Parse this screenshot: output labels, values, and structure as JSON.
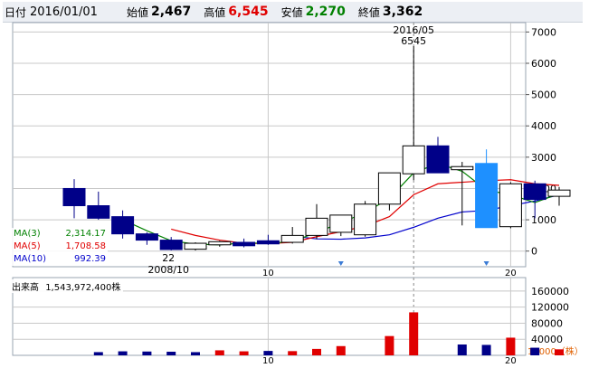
{
  "ohlc": {
    "date_label": "日付",
    "date": "2016/01/01",
    "open_label": "始値",
    "open": "2,467",
    "high_label": "高値",
    "high": "6,545",
    "low_label": "安値",
    "low": "2,270",
    "close_label": "終値",
    "close": "3,362"
  },
  "legend": {
    "ma3_label": "MA(3)",
    "ma3_value": "2,314.17",
    "ma3_color": "#008000",
    "ma5_label": "MA(5)",
    "ma5_value": "1,708.58",
    "ma5_color": "#e00000",
    "ma10_label": "MA(10)",
    "ma10_value": "992.39",
    "ma10_color": "#0000cc"
  },
  "volume_legend": {
    "label": "出来高",
    "value": "1,543,972,400株"
  },
  "colors": {
    "up": "#e00000",
    "down": "#000088",
    "highlight": "#1e90ff",
    "grid": "#c8c8c8"
  },
  "chart_data": [
    {
      "type": "candlestick",
      "yticks": [
        "0",
        "1000",
        "2000",
        "3000",
        "4000",
        "5000",
        "6000",
        "7000"
      ],
      "ylim": [
        -500,
        7300
      ],
      "xticks": [
        {
          "index": 8,
          "label": "10"
        },
        {
          "index": 18,
          "label": "20"
        }
      ],
      "candles": [
        {
          "o": 2000,
          "h": 2300,
          "l": 1050,
          "c": 1450
        },
        {
          "o": 1450,
          "h": 1900,
          "l": 1000,
          "c": 1050
        },
        {
          "o": 1100,
          "h": 1300,
          "l": 400,
          "c": 550
        },
        {
          "o": 550,
          "h": 600,
          "l": 200,
          "c": 350
        },
        {
          "o": 350,
          "h": 450,
          "l": 22,
          "c": 50
        },
        {
          "o": 60,
          "h": 280,
          "l": 20,
          "c": 250
        },
        {
          "o": 200,
          "h": 330,
          "l": 140,
          "c": 300
        },
        {
          "o": 280,
          "h": 400,
          "l": 120,
          "c": 170
        },
        {
          "o": 330,
          "h": 520,
          "l": 200,
          "c": 230
        },
        {
          "o": 280,
          "h": 770,
          "l": 240,
          "c": 500
        },
        {
          "o": 500,
          "h": 1500,
          "l": 380,
          "c": 1050
        },
        {
          "o": 600,
          "h": 1000,
          "l": 480,
          "c": 1150
        },
        {
          "o": 520,
          "h": 1600,
          "l": 460,
          "c": 1500
        },
        {
          "o": 1500,
          "h": 2500,
          "l": 1300,
          "c": 2500
        },
        {
          "o": 2470,
          "h": 6545,
          "l": 2270,
          "c": 3362
        },
        {
          "o": 3362,
          "h": 3650,
          "l": 2700,
          "c": 2500
        },
        {
          "o": 2600,
          "h": 2850,
          "l": 820,
          "c": 2700
        },
        {
          "o": 2800,
          "h": 3250,
          "l": 800,
          "c": 750,
          "highlight": true
        },
        {
          "o": 780,
          "h": 2200,
          "l": 730,
          "c": 2150
        },
        {
          "o": 2150,
          "h": 2250,
          "l": 1050,
          "c": 1650
        },
        {
          "o": 1750,
          "h": 2050,
          "l": 1450,
          "c": 1950
        }
      ],
      "ma3": [
        null,
        null,
        1000,
        650,
        330,
        220,
        200,
        260,
        250,
        300,
        600,
        900,
        1230,
        1680,
        2500,
        2800,
        2550,
        1950,
        1800,
        1550,
        1830
      ],
      "ma5": [
        null,
        null,
        null,
        null,
        700,
        500,
        350,
        250,
        240,
        280,
        460,
        620,
        800,
        1100,
        1800,
        2150,
        2200,
        2250,
        2280,
        2150,
        2100
      ],
      "ma10": [
        null,
        null,
        null,
        null,
        null,
        null,
        null,
        null,
        null,
        480,
        390,
        380,
        420,
        520,
        760,
        1050,
        1250,
        1300,
        1450,
        1600,
        1800
      ],
      "annotations": [
        {
          "index": 14,
          "date": "2016/05",
          "value": "6545"
        },
        {
          "index": 4,
          "date": "2008/10",
          "value": "22"
        }
      ]
    },
    {
      "type": "bar",
      "title": "出来高",
      "yticks": [
        "40000",
        "80000",
        "120000",
        "160000"
      ],
      "ylim": [
        0,
        180000
      ],
      "unit": "10000（株）",
      "values": [
        8000,
        10000,
        9500,
        9000,
        8000,
        12500,
        10000,
        11000,
        10500,
        16000,
        23000,
        48000,
        107000,
        27000,
        26000,
        44000,
        19000,
        15000
      ],
      "bar_indices": [
        1,
        2,
        3,
        4,
        5,
        6,
        7,
        8,
        9,
        10,
        11,
        13,
        14,
        16,
        17,
        18,
        19,
        20
      ],
      "bar_up": [
        false,
        false,
        false,
        false,
        false,
        true,
        true,
        false,
        true,
        true,
        true,
        true,
        true,
        false,
        false,
        true,
        false,
        true
      ],
      "xticks": [
        {
          "index": 8,
          "label": "10"
        },
        {
          "index": 18,
          "label": "20"
        }
      ]
    }
  ]
}
